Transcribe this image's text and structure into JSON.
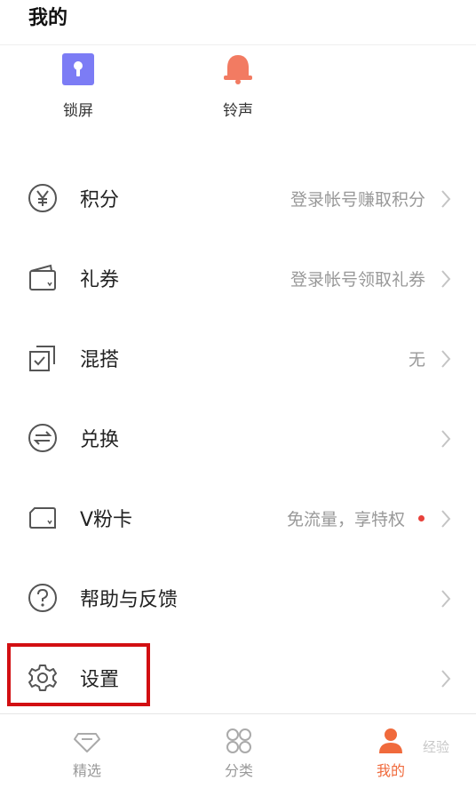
{
  "header": {
    "title": "我的"
  },
  "shortcuts": [
    {
      "label": "锁屏",
      "icon": "lock-screen-icon",
      "color": "#7c7cf5"
    },
    {
      "label": "铃声",
      "icon": "bell-icon",
      "color": "#f27b62"
    }
  ],
  "menu": [
    {
      "label": "积分",
      "value": "登录帐号赚取积分",
      "icon": "yen-icon"
    },
    {
      "label": "礼券",
      "value": "登录帐号领取礼券",
      "icon": "wallet-icon"
    },
    {
      "label": "混搭",
      "value": "无",
      "icon": "mix-check-icon"
    },
    {
      "label": "兑换",
      "value": "",
      "icon": "exchange-icon"
    },
    {
      "label": "V粉卡",
      "value": "免流量，享特权",
      "icon": "card-icon",
      "dot_color": "#e8413b"
    },
    {
      "label": "帮助与反馈",
      "value": "",
      "icon": "help-icon"
    },
    {
      "label": "设置",
      "value": "",
      "icon": "gear-icon"
    }
  ],
  "tabbar": [
    {
      "label": "精选",
      "icon": "diamond-icon",
      "active": false
    },
    {
      "label": "分类",
      "icon": "grid-icon",
      "active": false
    },
    {
      "label": "我的",
      "icon": "user-icon",
      "active": true
    }
  ],
  "watermark": "经验",
  "colors": {
    "accent": "#f06a3c",
    "highlight": "#d20f12",
    "muted": "#999999"
  }
}
